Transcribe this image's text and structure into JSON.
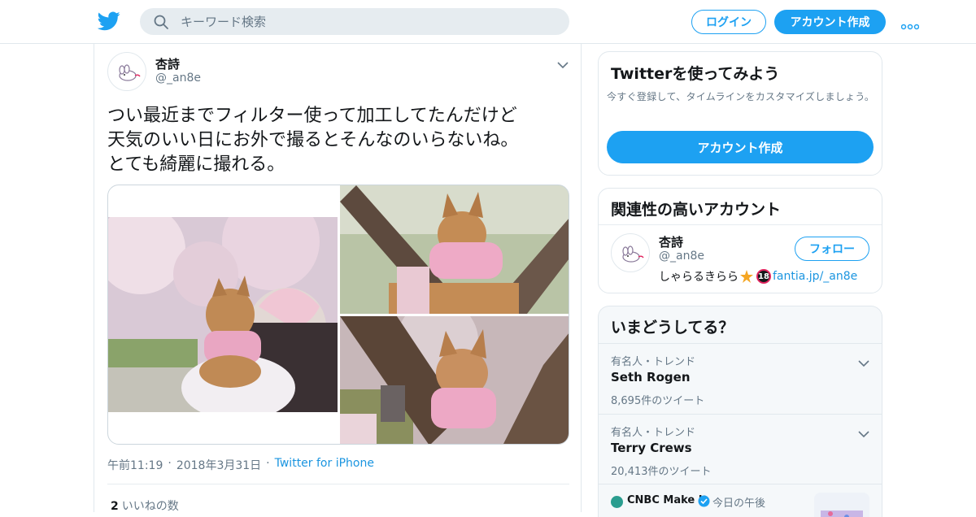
{
  "header": {
    "search_placeholder": "キーワード検索",
    "login_label": "ログイン",
    "signup_label": "アカウント作成",
    "accent": "#1da1f2"
  },
  "tweet": {
    "name": "杏詩",
    "handle": "@_an8e",
    "text": "つい最近までフィルター使って加工してたんだけど\n天気のいい日にお外で撮るとそんなのいらないね。\nとても綺麗に撮れる。",
    "time": "午前11:19",
    "date": "2018年3月31日",
    "source": "Twitter for iPhone",
    "likes_count": "2",
    "likes_label": "いいねの数"
  },
  "try_twitter": {
    "title": "Twitterを使ってみよう",
    "description": "今すぐ登録して、タイムラインをカスタマイズしましょう。",
    "button_label": "アカウント作成"
  },
  "related": {
    "title": "関連性の高いアカウント",
    "name": "杏詩",
    "handle": "@_an8e",
    "follow_label": "フォロー",
    "bio_text": "しゃらるきらら",
    "bio_badge": "18",
    "bio_link": "fantia.jp/_an8e"
  },
  "trends": {
    "title": "いまどうしてる？",
    "items": [
      {
        "context": "有名人・トレンド",
        "name": "Seth Rogen",
        "count": "8,695件のツイート"
      },
      {
        "context": "有名人・トレンド",
        "name": "Terry Crews",
        "count": "20,413件のツイート"
      }
    ],
    "news": {
      "source": "CNBC Make It",
      "time": "今日の午後"
    }
  }
}
